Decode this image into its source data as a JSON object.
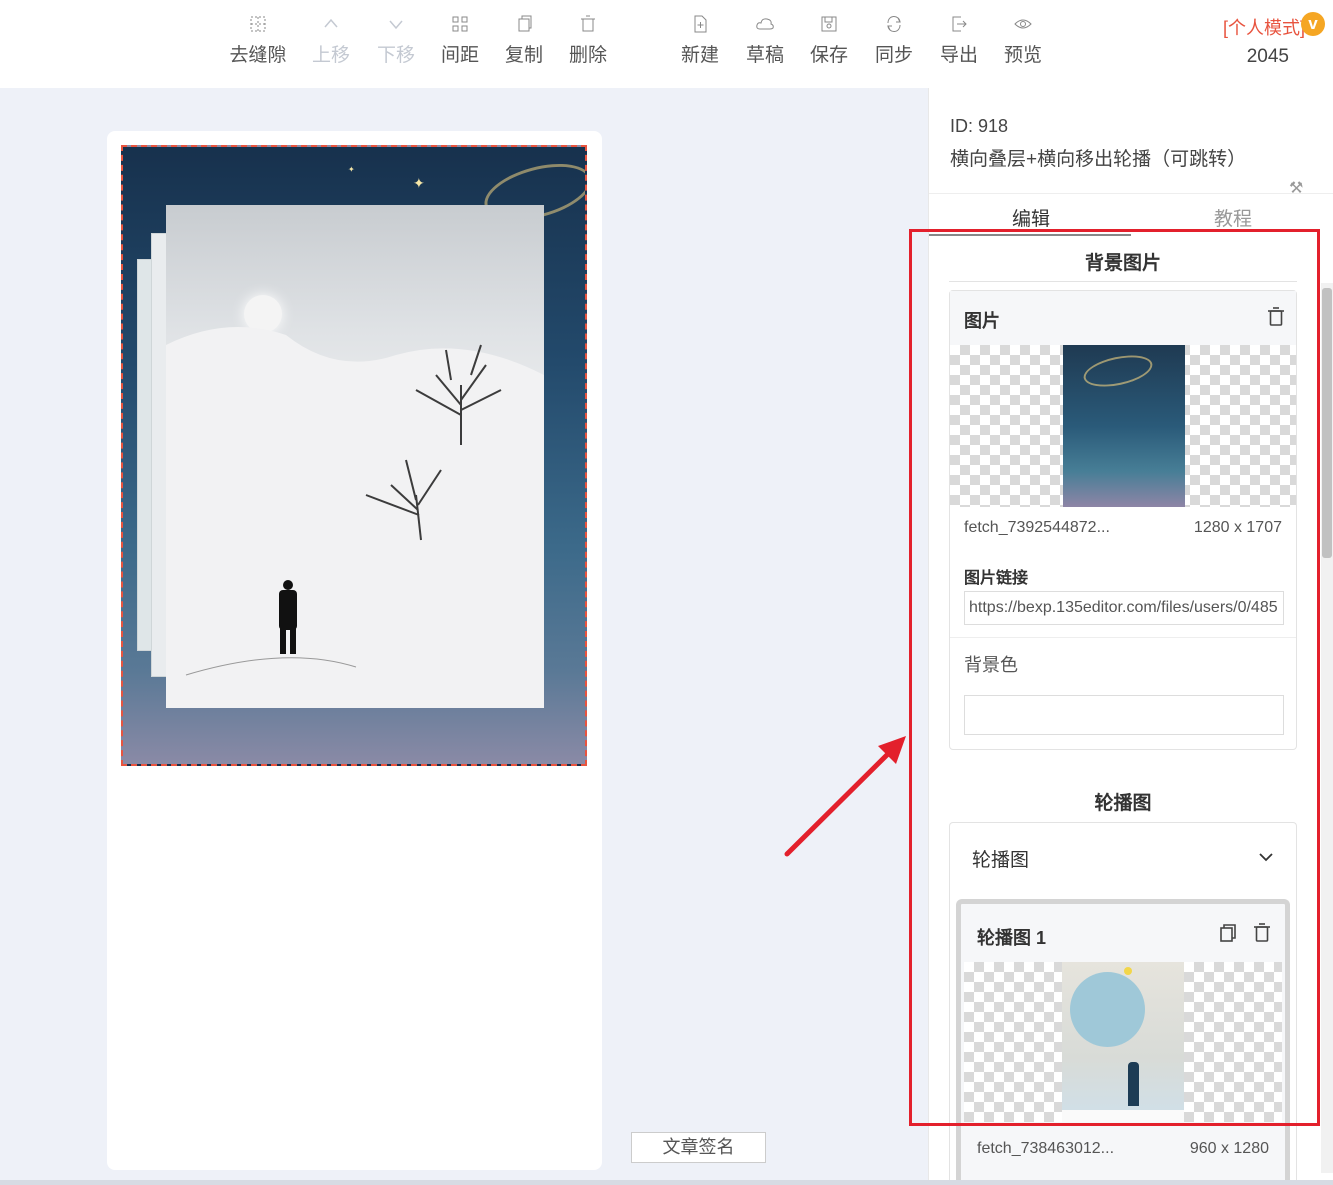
{
  "toolbar": {
    "tools_left": [
      {
        "label": "去缝隙",
        "icon": "grid-dashed-icon"
      },
      {
        "label": "上移",
        "icon": "chevron-up-icon"
      },
      {
        "label": "下移",
        "icon": "chevron-down-icon"
      },
      {
        "label": "间距",
        "icon": "spacing-icon"
      },
      {
        "label": "复制",
        "icon": "copy-icon"
      },
      {
        "label": "删除",
        "icon": "trash-icon"
      }
    ],
    "tools_right": [
      {
        "label": "新建",
        "icon": "new-file-icon"
      },
      {
        "label": "草稿",
        "icon": "cloud-icon"
      },
      {
        "label": "保存",
        "icon": "save-icon"
      },
      {
        "label": "同步",
        "icon": "sync-icon"
      },
      {
        "label": "导出",
        "icon": "export-icon"
      },
      {
        "label": "预览",
        "icon": "eye-icon"
      }
    ],
    "mode_label": "[个人模式]",
    "vip_badge": "v",
    "count": "2045"
  },
  "canvas": {
    "sign_button": "文章签名"
  },
  "panel": {
    "id_label": "ID: 918",
    "template_name": "横向叠层+横向移出轮播（可跳转）",
    "tabs": {
      "edit": "编辑",
      "tutorial": "教程"
    },
    "background_section": {
      "title": "背景图片",
      "image_box_title": "图片",
      "file_name": "fetch_7392544872...",
      "file_dims": "1280 x 1707",
      "link_label": "图片链接",
      "link_value": "https://bexp.135editor.com/files/users/0/485",
      "bgcolor_label": "背景色",
      "bgcolor_value": ""
    },
    "carousel_section": {
      "title": "轮播图",
      "collapse_title": "轮播图",
      "item_title": "轮播图 1",
      "file_name": "fetch_738463012...",
      "file_dims": "960 x 1280"
    }
  },
  "colors": {
    "accent_red": "#e3202c",
    "mode_orange": "#e8543f",
    "vip_gold": "#f5a623",
    "canvas_bg": "#eef1f8"
  }
}
